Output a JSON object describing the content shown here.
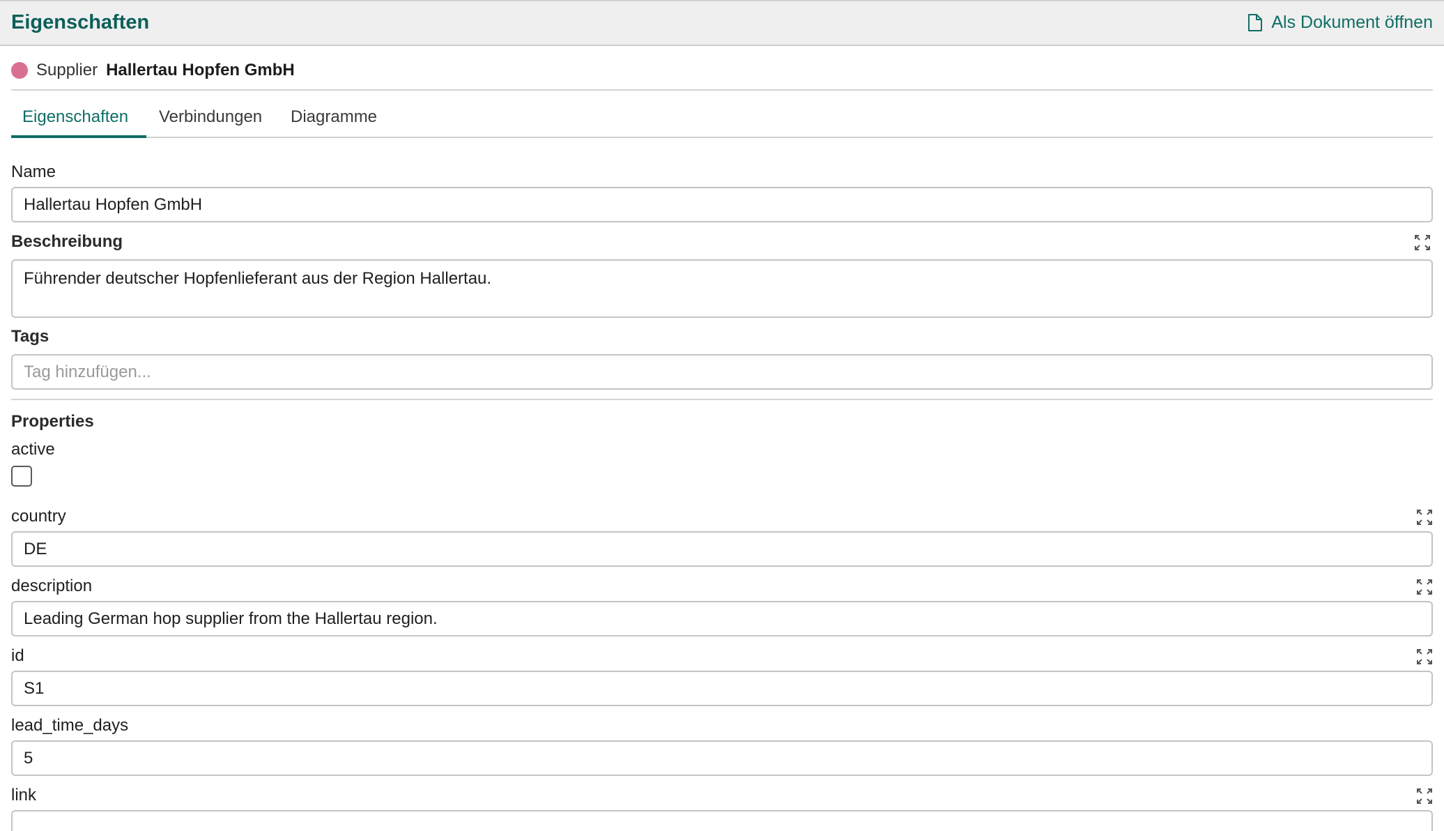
{
  "header": {
    "title": "Eigenschaften",
    "open_document_label": "Als Dokument öffnen",
    "icon": "document-icon",
    "accent_color": "#0f6e66"
  },
  "entity": {
    "type": "Supplier",
    "name": "Hallertau Hopfen GmbH",
    "dot_color": "#d9708f"
  },
  "tabs": [
    {
      "label": "Eigenschaften",
      "active": true
    },
    {
      "label": "Verbindungen",
      "active": false
    },
    {
      "label": "Diagramme",
      "active": false
    }
  ],
  "fields": {
    "name": {
      "label": "Name",
      "value": "Hallertau Hopfen GmbH"
    },
    "beschreibung": {
      "label": "Beschreibung",
      "value": "Führender deutscher Hopfenlieferant aus der Region Hallertau."
    },
    "tags": {
      "label": "Tags",
      "placeholder": "Tag hinzufügen..."
    }
  },
  "properties": {
    "heading": "Properties",
    "active": {
      "label": "active",
      "checked": false
    },
    "country": {
      "label": "country",
      "value": "DE"
    },
    "description": {
      "label": "description",
      "value": "Leading German hop supplier from the Hallertau region."
    },
    "id": {
      "label": "id",
      "value": "S1"
    },
    "lead_time_days": {
      "label": "lead_time_days",
      "value": "5"
    },
    "link": {
      "label": "link",
      "value": ""
    }
  }
}
